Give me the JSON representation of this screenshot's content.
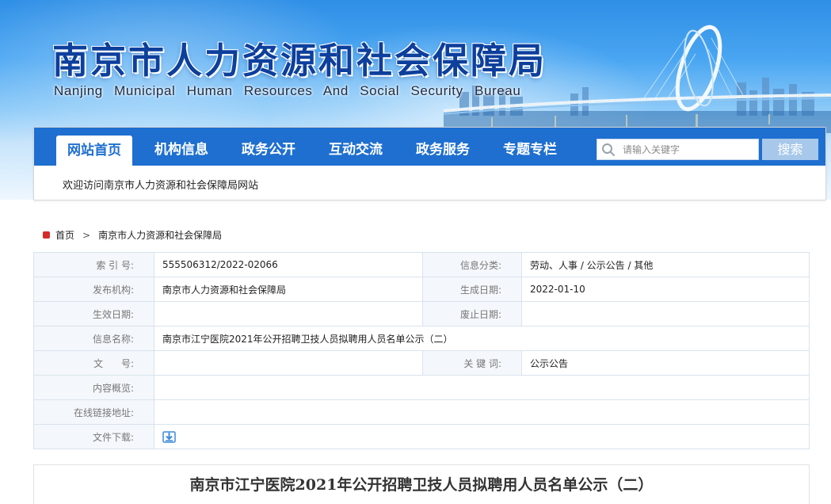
{
  "site": {
    "title": "南京市人力资源和社会保障局",
    "subtitle": "Nanjing Municipal Human Resources And Social Security Bureau"
  },
  "nav": {
    "items": [
      {
        "label": "网站首页",
        "active": true
      },
      {
        "label": "机构信息",
        "active": false
      },
      {
        "label": "政务公开",
        "active": false
      },
      {
        "label": "互动交流",
        "active": false
      },
      {
        "label": "政务服务",
        "active": false
      },
      {
        "label": "专题专栏",
        "active": false
      }
    ],
    "search": {
      "placeholder": "请输入关键字",
      "button_label": "搜索",
      "icon": "search-icon"
    },
    "welcome": "欢迎访问南京市人力资源和社会保障局网站"
  },
  "breadcrumb": {
    "icon": "home-icon",
    "items": [
      "首页",
      "南京市人力资源和社会保障局"
    ],
    "separator": ">"
  },
  "info": {
    "index_label": "索 引 号:",
    "index_value": "555506312/2022-02066",
    "category_label": "信息分类:",
    "category_value": "劳动、人事 / 公示公告 / 其他",
    "publisher_label": "发布机构:",
    "publisher_value": "南京市人力资源和社会保障局",
    "created_label": "生成日期:",
    "created_value": "2022-01-10",
    "effective_label": "生效日期:",
    "effective_value": "",
    "expiry_label": "废止日期:",
    "expiry_value": "",
    "name_label": "信息名称:",
    "name_value": "南京市江宁医院2021年公开招聘卫技人员拟聘用人员名单公示（二）",
    "docno_label": "文      号:",
    "docno_value": "",
    "keywords_label": "关 键 词:",
    "keywords_value": "公示公告",
    "summary_label": "内容概览:",
    "summary_value": "",
    "link_label": "在线链接地址:",
    "link_value": "",
    "download_label": "文件下载:",
    "download_icon": "download-icon"
  },
  "article": {
    "title": "南京市江宁医院2021年公开招聘卫技人员拟聘用人员名单公示（二）"
  },
  "colors": {
    "nav_blue": "#1e6fd0",
    "title_blue": "#0d3f9c",
    "search_button": "#a7c8ea",
    "home_icon_red": "#d62b2b"
  }
}
